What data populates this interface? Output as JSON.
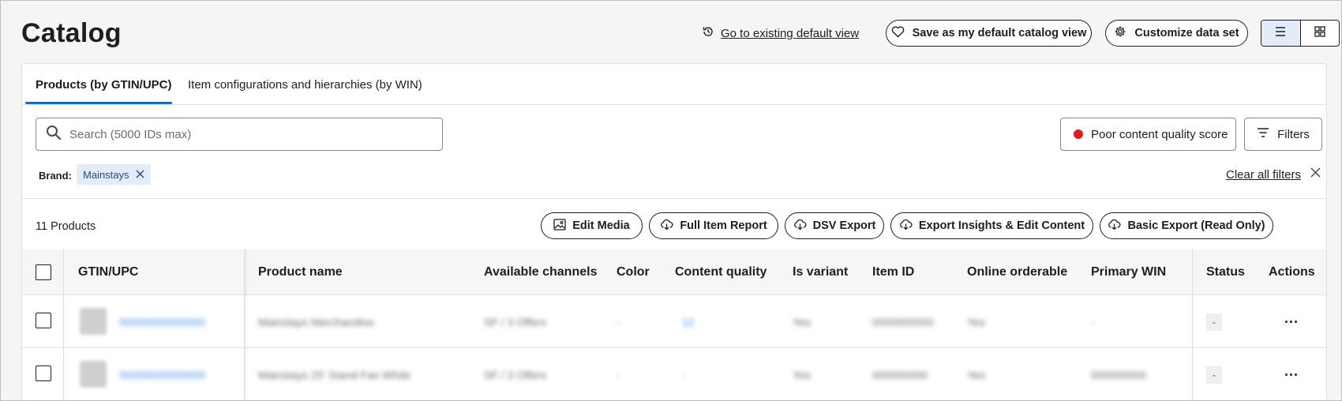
{
  "header": {
    "title": "Catalog",
    "go_default_label": "Go to existing default view",
    "save_default_label": "Save as my default catalog view",
    "customize_label": "Customize data set"
  },
  "tabs": [
    {
      "label": "Products (by GTIN/UPC)",
      "active": true
    },
    {
      "label": "Item configurations and hierarchies (by WIN)",
      "active": false
    }
  ],
  "search": {
    "placeholder": "Search (5000 IDs max)",
    "value": ""
  },
  "quality_filter": {
    "label": "Poor content quality score",
    "color": "#de1c24"
  },
  "filters_label": "Filters",
  "active_filters": {
    "brand_label": "Brand:",
    "brand_value": "Mainstays",
    "clear_all": "Clear all filters"
  },
  "results": {
    "count": "11 Products",
    "actions": [
      {
        "label": "Edit Media",
        "icon": "image-icon"
      },
      {
        "label": "Full Item Report",
        "icon": "cloud-download-icon"
      },
      {
        "label": "DSV Export",
        "icon": "cloud-download-icon"
      },
      {
        "label": "Export Insights & Edit Content",
        "icon": "cloud-download-icon"
      },
      {
        "label": "Basic Export (Read Only)",
        "icon": "cloud-download-icon"
      }
    ]
  },
  "table": {
    "columns": [
      "GTIN/UPC",
      "Product name",
      "Available channels",
      "Color",
      "Content quality",
      "Is variant",
      "Item ID",
      "Online orderable",
      "Primary WIN",
      "Status",
      "Actions"
    ],
    "rows": [
      {
        "gtin": "00000000000000",
        "name": "Mainstays Merchandise",
        "channels": "SF / 3 Offers",
        "color": "-",
        "quality": "12",
        "variant": "Yes",
        "item_id": "0000000000",
        "orderable": "Yes",
        "win": "-",
        "status": "-",
        "actions": "..."
      },
      {
        "gtin": "00000000000000",
        "name": "Mainstays 25' Stand Fan White",
        "channels": "SF / 3 Offers",
        "color": "-",
        "quality": "-",
        "variant": "Yes",
        "item_id": "000000000",
        "orderable": "Yes",
        "win": "000000000",
        "status": "-",
        "actions": "..."
      }
    ]
  },
  "colors": {
    "accent": "#0071dc",
    "chip_bg": "#e3edf9"
  }
}
